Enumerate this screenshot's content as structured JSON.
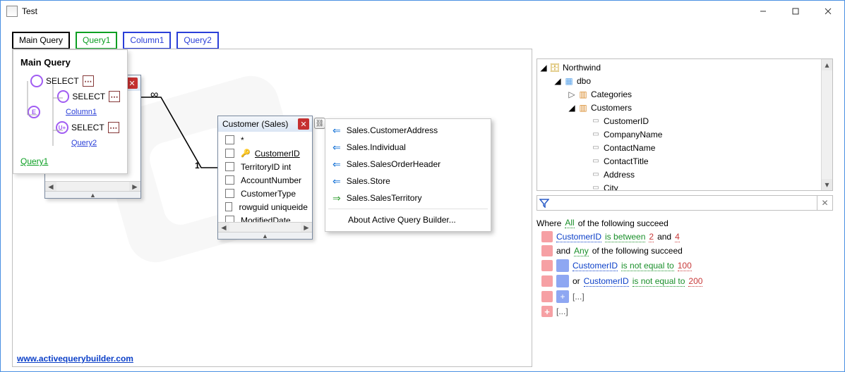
{
  "window": {
    "title": "Test"
  },
  "tabs": {
    "main": "Main Query",
    "q1": "Query1",
    "col1": "Column1",
    "q2": "Query2"
  },
  "dropdown": {
    "heading": "Main Query",
    "select": "SELECT",
    "e_label": "E",
    "uplus_label": "U+",
    "column1": "Column1",
    "query2": "Query2",
    "query1": "Query1",
    "dots": "⋯"
  },
  "join": {
    "inf": "∞",
    "one": "1"
  },
  "customerTable": {
    "title": "Customer (Sales)",
    "cols": [
      "*",
      "CustomerID",
      "TerritoryID int",
      "AccountNumber",
      "CustomerType",
      "rowguid uniqueidentifier",
      "ModifiedDate"
    ]
  },
  "contextMenu": {
    "items": [
      "Sales.CustomerAddress",
      "Sales.Individual",
      "Sales.SalesOrderHeader",
      "Sales.Store",
      "Sales.SalesTerritory"
    ],
    "about": "About Active Query Builder..."
  },
  "footer": {
    "link": "www.activequerybuilder.com"
  },
  "tree": {
    "db": "Northwind",
    "schema": "dbo",
    "categories": "Categories",
    "customers": "Customers",
    "cols": [
      "CustomerID",
      "CompanyName",
      "ContactName",
      "ContactTitle",
      "Address",
      "City"
    ]
  },
  "criteria": {
    "where": "Where",
    "all": "All",
    "succeed": "of the following succeed",
    "field": "CustomerID",
    "isBetween": "is between",
    "v1": "2",
    "and_word": "and",
    "v2": "4",
    "and2": "and",
    "any": "Any",
    "notEqual": "is not equal to",
    "hundred": "100",
    "or": "or",
    "twoHundred": "200",
    "ellipsis": "[...]"
  }
}
